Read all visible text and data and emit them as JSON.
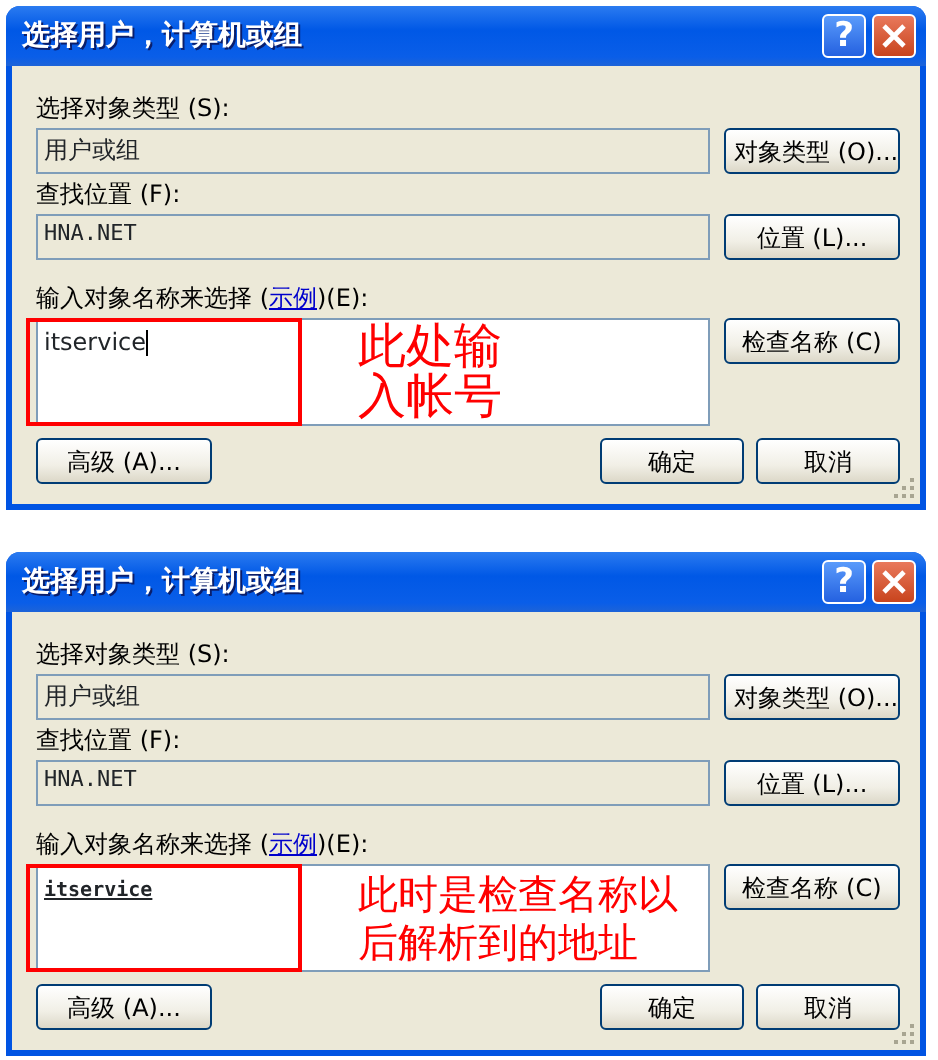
{
  "dialogs": [
    {
      "title": "选择用户，计算机或组",
      "help": "?",
      "object_types": {
        "label": "选择对象类型 (S):",
        "value": "用户或组",
        "button": "对象类型 (O)..."
      },
      "location": {
        "label": "查找位置 (F):",
        "value": "HNA.NET",
        "button": "位置 (L)..."
      },
      "names": {
        "label_before": "输入对象名称来选择 (",
        "link": "示例",
        "label_after": ")(E):",
        "value": "itservice",
        "resolved": false,
        "caret": true,
        "button": "检查名称 (C)"
      },
      "buttons": {
        "advanced": "高级 (A)...",
        "ok": "确定",
        "cancel": "取消"
      },
      "annotation": {
        "text": "此处输入帐号",
        "highlight": true
      }
    },
    {
      "title": "选择用户，计算机或组",
      "help": "?",
      "object_types": {
        "label": "选择对象类型 (S):",
        "value": "用户或组",
        "button": "对象类型 (O)..."
      },
      "location": {
        "label": "查找位置 (F):",
        "value": "HNA.NET",
        "button": "位置 (L)..."
      },
      "names": {
        "label_before": "输入对象名称来选择 (",
        "link": "示例",
        "label_after": ")(E):",
        "value": "itservice",
        "resolved": true,
        "caret": false,
        "button": "检查名称 (C)"
      },
      "buttons": {
        "advanced": "高级 (A)...",
        "ok": "确定",
        "cancel": "取消"
      },
      "annotation": {
        "text": "此时是检查名称以后解析到的地址",
        "highlight": true
      }
    }
  ]
}
